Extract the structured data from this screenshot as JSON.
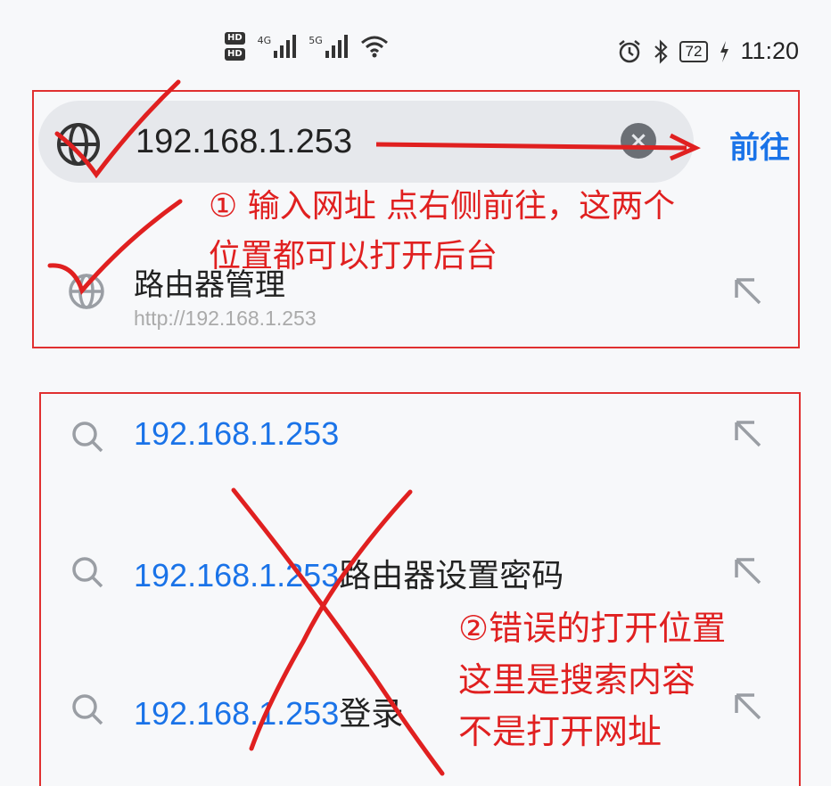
{
  "status_bar": {
    "hd1": "HD",
    "hd2": "HD",
    "sim1_network": "4G",
    "sim2_network": "5G",
    "battery": "72",
    "time": "11:20"
  },
  "address_bar": {
    "value": "192.168.1.253",
    "go_label": "前往"
  },
  "annotations": {
    "step1_line1": "① 输入网址 点右侧前往，这两个",
    "step1_line2": "位置都可以打开后台",
    "step2_line1": "②错误的打开位置",
    "step2_line2": "这里是搜索内容",
    "step2_line3": "不是打开网址"
  },
  "site_suggestion": {
    "title": "路由器管理",
    "url": "http://192.168.1.253"
  },
  "search_suggestions": [
    {
      "query": "192.168.1.253",
      "suffix": ""
    },
    {
      "query": "192.168.1.253",
      "suffix": "路由器设置密码"
    },
    {
      "query": "192.168.1.253",
      "suffix": "登录"
    }
  ],
  "colors": {
    "accent": "#1a73e8",
    "annotation": "#e02020"
  }
}
